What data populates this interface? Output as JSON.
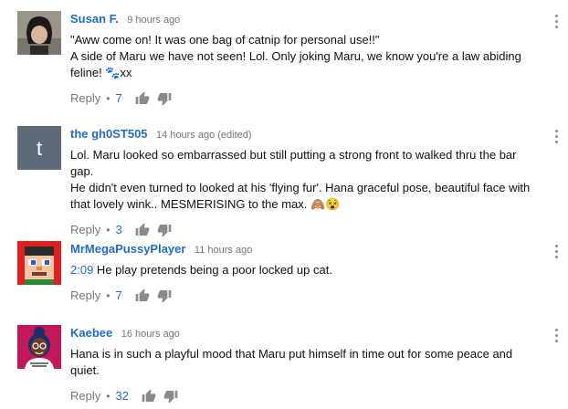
{
  "comments": [
    {
      "author": "Susan F.",
      "time": "9 hours ago",
      "text_lines": [
        "\"Aww come on! It was one bag of catnip for personal use!!\"",
        "A side of Maru we have not seen! Lol. Only joking Maru, we know you're a law abiding",
        "feline! 🐾xx"
      ],
      "reply_label": "Reply",
      "likes": "7",
      "avatar": "photo-avatar-dark-hair"
    },
    {
      "author": "the gh0ST505",
      "time": "14 hours ago (edited)",
      "text_lines": [
        "Lol. Maru looked so embarrassed but still putting a strong front to walked thru the bar gap.",
        "He didn't even turned to looked at his 'flying fur'. Hana graceful pose, beautiful face with",
        "that lovely wink.. MESMERISING to the max. 🙈😵"
      ],
      "reply_label": "Reply",
      "likes": "3",
      "avatar_letter": "t",
      "avatar_color": "#5f6b78"
    },
    {
      "author": "MrMegaPussyPlayer",
      "time": "11 hours ago",
      "timestamp_link": "2:09",
      "text_after_link": " He play pretends being a poor locked up cat.",
      "reply_label": "Reply",
      "likes": "7",
      "avatar": "pixel-face-avatar"
    },
    {
      "author": "Kaebee",
      "time": "16 hours ago",
      "text_lines": [
        "Hana is in such a playful mood that Maru put himself in time out for some peace and",
        "quiet."
      ],
      "reply_label": "Reply",
      "likes": "32",
      "avatar": "cartoon-woman-avatar"
    }
  ],
  "separator": "•",
  "icons": [
    "thumbs-up-icon",
    "thumbs-down-icon",
    "more-vert-icon"
  ],
  "colors": {
    "link": "#1f6bc6",
    "muted": "#767676",
    "icon": "#8a8a8a"
  }
}
